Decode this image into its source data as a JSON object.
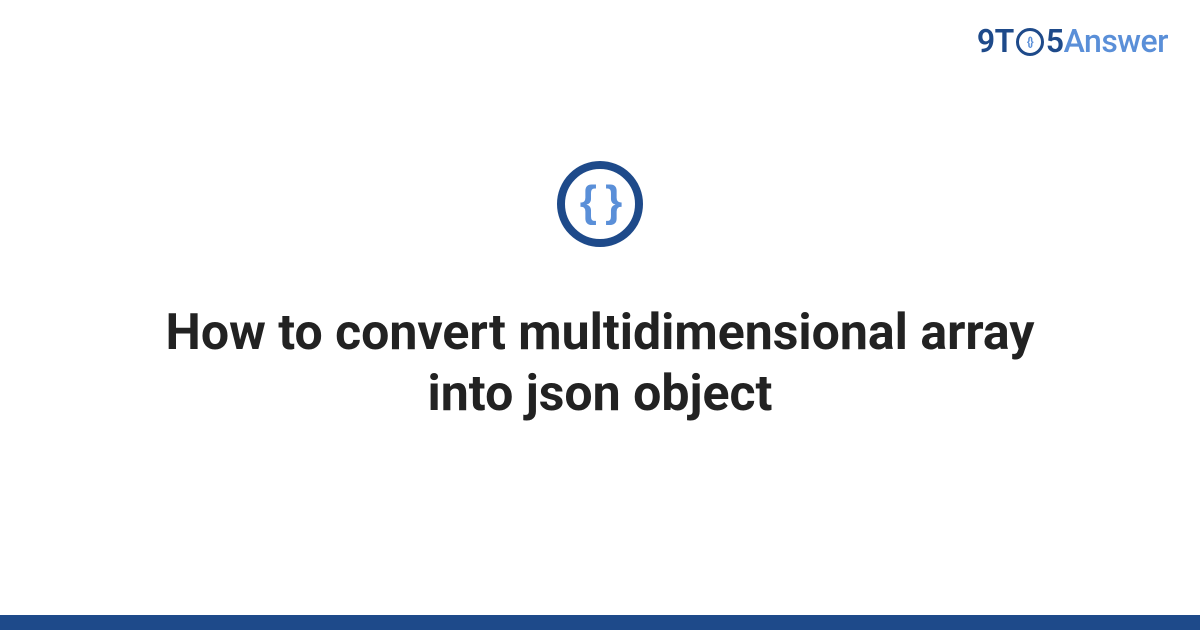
{
  "logo": {
    "part_9t": "9T",
    "circle_inner": "{}",
    "part_5": "5",
    "part_answer": "Answer"
  },
  "icon": {
    "braces": "{ }"
  },
  "title": "How to convert multidimensional array into json object"
}
